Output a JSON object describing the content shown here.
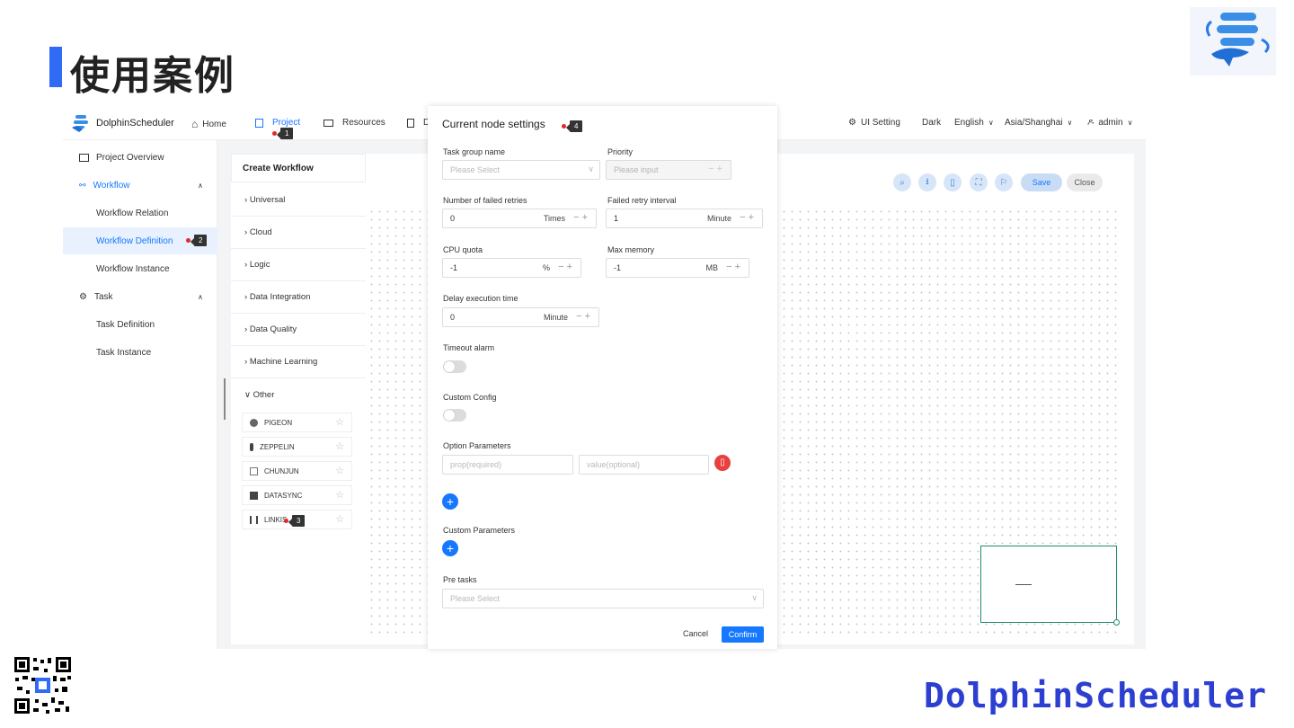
{
  "slide": {
    "title": "使用案例",
    "brand": "DolphinScheduler"
  },
  "topbar": {
    "app_name": "DolphinScheduler",
    "nav": [
      "Home",
      "Project",
      "Resources",
      "D"
    ],
    "ui_setting": "UI Setting",
    "theme": "Dark",
    "language": "English",
    "timezone": "Asia/Shanghai",
    "user": "admin"
  },
  "sidebar": {
    "items": [
      {
        "label": "Project Overview"
      },
      {
        "label": "Workflow"
      },
      {
        "label": "Workflow Relation"
      },
      {
        "label": "Workflow Definition"
      },
      {
        "label": "Workflow Instance"
      },
      {
        "label": "Task"
      },
      {
        "label": "Task Definition"
      },
      {
        "label": "Task Instance"
      }
    ]
  },
  "workflow": {
    "header": "Create Workflow",
    "categories": [
      "Universal",
      "Cloud",
      "Logic",
      "Data Integration",
      "Data Quality",
      "Machine Learning",
      "Other"
    ],
    "tasks": [
      "PIGEON",
      "ZEPPELIN",
      "CHUNJUN",
      "DATASYNC",
      "LINKIS"
    ],
    "save": "Save",
    "close": "Close"
  },
  "markers": [
    "1",
    "2",
    "3",
    "4"
  ],
  "modal": {
    "title": "Current node settings",
    "task_group_label": "Task group name",
    "task_group_placeholder": "Please Select",
    "priority_label": "Priority",
    "priority_placeholder": "Please input",
    "failed_retries_label": "Number of failed retries",
    "failed_retries_value": "0",
    "failed_retries_unit": "Times",
    "retry_interval_label": "Failed retry interval",
    "retry_interval_value": "1",
    "retry_interval_unit": "Minute",
    "cpu_label": "CPU quota",
    "cpu_value": "-1",
    "cpu_unit": "%",
    "mem_label": "Max memory",
    "mem_value": "-1",
    "mem_unit": "MB",
    "delay_label": "Delay execution time",
    "delay_value": "0",
    "delay_unit": "Minute",
    "timeout_label": "Timeout alarm",
    "custom_config_label": "Custom Config",
    "option_params_label": "Option Parameters",
    "prop_placeholder": "prop(required)",
    "value_placeholder": "value(optional)",
    "custom_params_label": "Custom Parameters",
    "pre_tasks_label": "Pre tasks",
    "pre_tasks_placeholder": "Please Select",
    "cancel": "Cancel",
    "confirm": "Confirm"
  },
  "colors": {
    "accent": "#1677ff",
    "title_bar": "#2f6bf5",
    "marker_dot": "#e3262a",
    "minimap_border": "#1f8a70"
  }
}
